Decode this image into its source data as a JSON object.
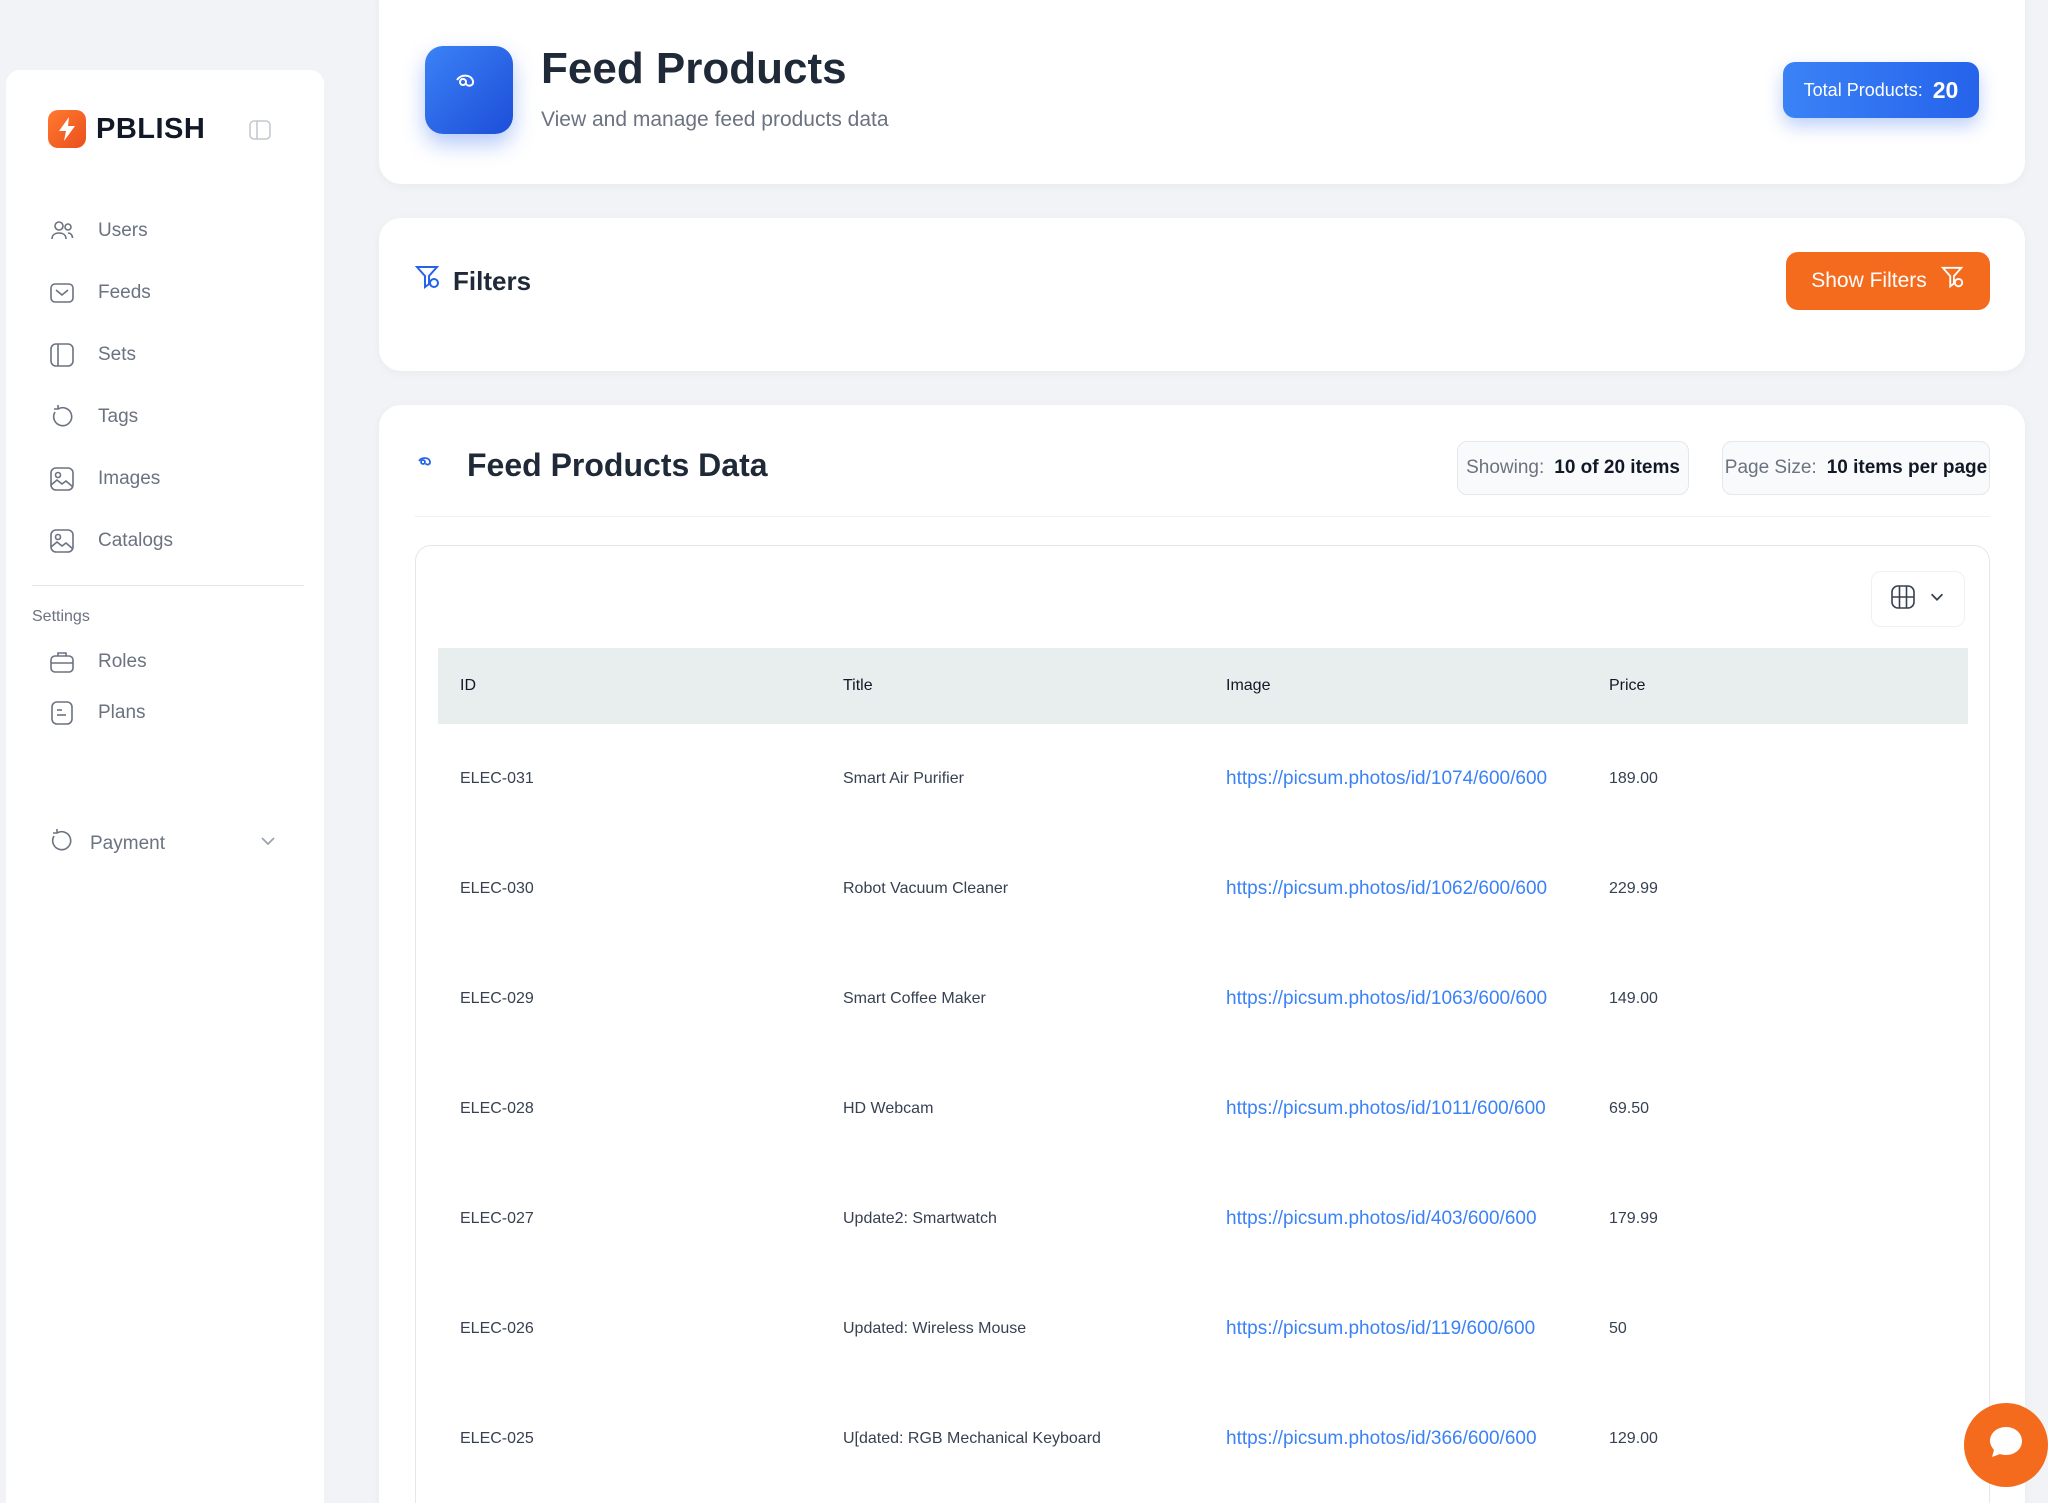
{
  "brand": {
    "name": "PBLISH"
  },
  "sidebar": {
    "items": [
      {
        "label": "Users",
        "icon": "users-icon"
      },
      {
        "label": "Feeds",
        "icon": "inbox-icon"
      },
      {
        "label": "Sets",
        "icon": "panel-icon"
      },
      {
        "label": "Tags",
        "icon": "refresh-icon"
      },
      {
        "label": "Images",
        "icon": "image-icon"
      },
      {
        "label": "Catalogs",
        "icon": "image-icon"
      }
    ],
    "settings_label": "Settings",
    "settings_items": [
      {
        "label": "Roles",
        "icon": "briefcase-icon"
      },
      {
        "label": "Plans",
        "icon": "document-icon"
      }
    ],
    "payment_label": "Payment"
  },
  "header": {
    "title": "Feed Products",
    "subtitle": "View and manage feed products data",
    "total_label": "Total Products:",
    "total_value": "20"
  },
  "filters": {
    "title": "Filters",
    "button_label": "Show Filters"
  },
  "data": {
    "title": "Feed Products Data",
    "showing_label": "Showing:",
    "showing_value": "10 of 20 items",
    "page_size_label": "Page Size:",
    "page_size_value": "10 items per page"
  },
  "table": {
    "columns": [
      "ID",
      "Title",
      "Image",
      "Price"
    ],
    "rows": [
      {
        "id": "ELEC-031",
        "title": "Smart Air Purifier",
        "image": "https://picsum.photos/id/1074/600/600",
        "price": "189.00"
      },
      {
        "id": "ELEC-030",
        "title": "Robot Vacuum Cleaner",
        "image": "https://picsum.photos/id/1062/600/600",
        "price": "229.99"
      },
      {
        "id": "ELEC-029",
        "title": "Smart Coffee Maker",
        "image": "https://picsum.photos/id/1063/600/600",
        "price": "149.00"
      },
      {
        "id": "ELEC-028",
        "title": "HD Webcam",
        "image": "https://picsum.photos/id/1011/600/600",
        "price": "69.50"
      },
      {
        "id": "ELEC-027",
        "title": "Update2: Smartwatch",
        "image": "https://picsum.photos/id/403/600/600",
        "price": "179.99"
      },
      {
        "id": "ELEC-026",
        "title": "Updated: Wireless Mouse",
        "image": "https://picsum.photos/id/119/600/600",
        "price": "50"
      },
      {
        "id": "ELEC-025",
        "title": "U[dated: RGB Mechanical Keyboard",
        "image": "https://picsum.photos/id/366/600/600",
        "price": "129.00"
      }
    ]
  },
  "colors": {
    "accent_blue": "#2563eb",
    "accent_orange": "#f46b1e"
  }
}
